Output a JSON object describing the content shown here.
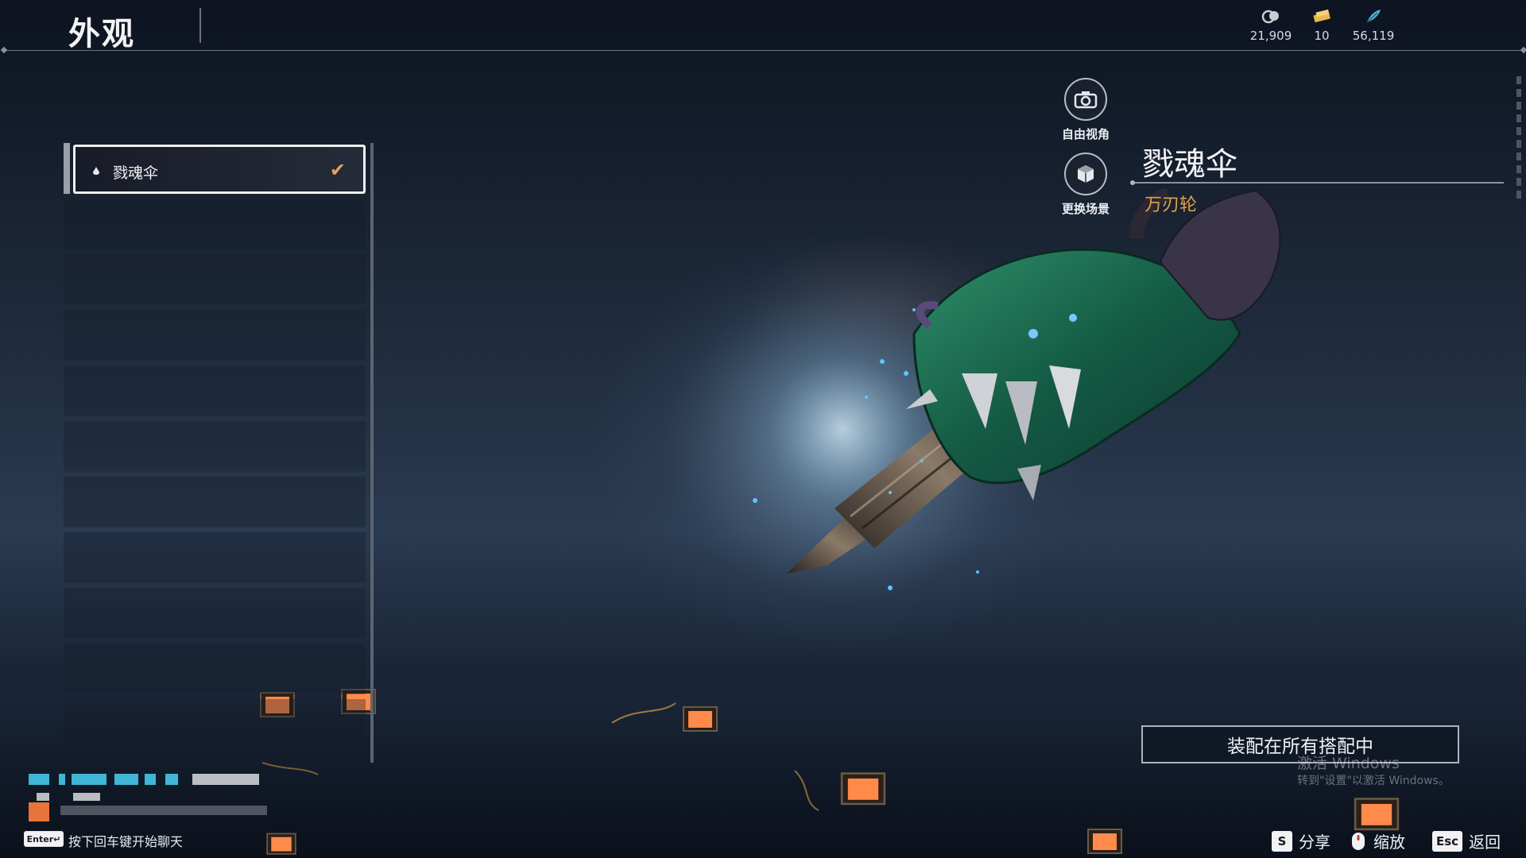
{
  "header": {
    "title": "外观"
  },
  "currencies": [
    {
      "icon": "coin-stack-icon",
      "value": "21,909",
      "color": "#c9ccd2"
    },
    {
      "icon": "ticket-icon",
      "value": "10",
      "color": "#e7b84a"
    },
    {
      "icon": "feather-icon",
      "value": "56,119",
      "color": "#4fb6d8"
    }
  ],
  "appearance_list": {
    "items": [
      {
        "label": "戮魂伞",
        "selected": true,
        "equipped": true
      }
    ]
  },
  "side_buttons": {
    "free_view": {
      "label": "自由视角",
      "icon": "camera-icon"
    },
    "change_scene": {
      "label": "更换场景",
      "icon": "scene-box-icon"
    }
  },
  "item_info": {
    "name": "戮魂伞",
    "category": "万刃轮",
    "accent_color": "#e0a24a"
  },
  "equip_button": {
    "label": "装配在所有搭配中"
  },
  "watermark": {
    "line1": "激活 Windows",
    "line2": "转到\"设置\"以激活 Windows。"
  },
  "chat": {
    "key": "Enter↵",
    "hint": "按下回车键开始聊天"
  },
  "key_hints": [
    {
      "key": "S",
      "label": "分享"
    },
    {
      "key": "🖱",
      "label": "缩放"
    },
    {
      "key": "Esc",
      "label": "返回"
    }
  ]
}
